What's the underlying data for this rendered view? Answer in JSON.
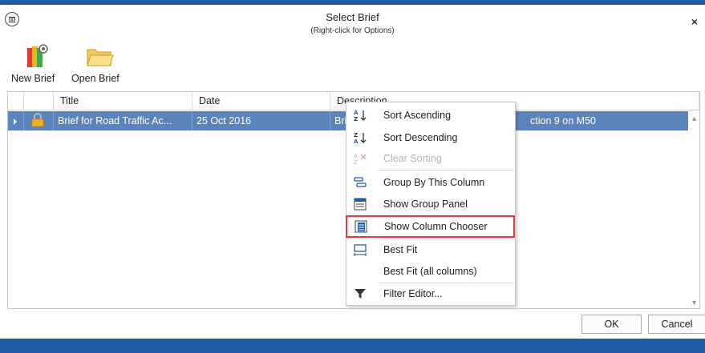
{
  "window": {
    "title": "Select Brief",
    "subtitle": "(Right-click for Options)",
    "close_glyph": "×"
  },
  "toolbar": {
    "new_brief_label": "New Brief",
    "open_brief_label": "Open Brief"
  },
  "grid": {
    "columns": [
      "Title",
      "Date",
      "Description"
    ],
    "rows": [
      {
        "title": "Brief for Road Traffic Ac...",
        "date": "25 Oct 2016",
        "description_start": "Bri",
        "description_end": "ction 9 on M50"
      }
    ]
  },
  "context_menu": {
    "items": [
      {
        "label": "Sort Ascending",
        "icon": "sort-ascending-icon"
      },
      {
        "label": "Sort Descending",
        "icon": "sort-descending-icon"
      },
      {
        "label": "Clear Sorting",
        "icon": "clear-sorting-icon",
        "disabled": true
      },
      {
        "label": "Group By This Column",
        "icon": "group-by-icon"
      },
      {
        "label": "Show Group Panel",
        "icon": "group-panel-icon"
      },
      {
        "label": "Show Column Chooser",
        "icon": "column-chooser-icon",
        "highlighted": true
      },
      {
        "label": "Best Fit",
        "icon": "best-fit-icon"
      },
      {
        "label": "Best Fit (all columns)",
        "icon": ""
      },
      {
        "label": "Filter Editor...",
        "icon": "filter-icon"
      }
    ]
  },
  "buttons": {
    "ok": "OK",
    "cancel": "Cancel"
  },
  "colors": {
    "accent": "#1e5fa8",
    "selected_row": "#5b84bd",
    "highlight_outline": "#e03c3c"
  }
}
